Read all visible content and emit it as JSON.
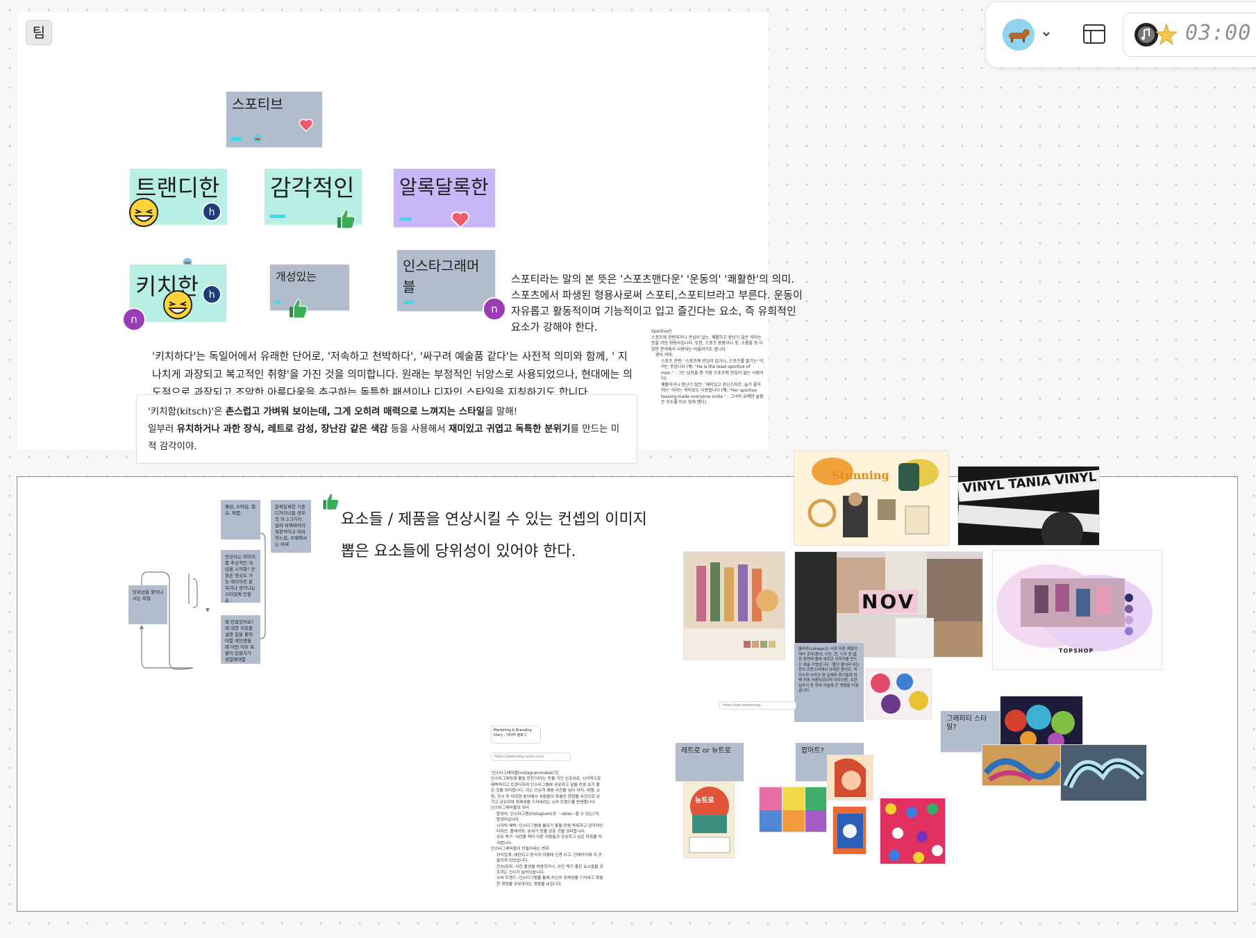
{
  "app": {
    "team_label": "팀",
    "timer": "03:00"
  },
  "board_top": {
    "stickies": {
      "root": "스포티브",
      "trendy": "트랜디한",
      "sensual": "감각적인",
      "colorful": "알록달록한",
      "kitschy": "키치한",
      "unique": "개성있는",
      "instagrammable": "인스타그래머블"
    },
    "avatars": {
      "h": "h",
      "n": "n"
    },
    "sporty_text": "스포티라는 말의 본 뜻은 '스포츠맨다운' '운동의' '쾌활한'의 의미. 스포츠에서 파생된 형용사로써 스포티,스포티브라고 부른다. 운동이 자유롭고 활동적이며 기능적이고 입고 즐긴다는 요소, 즉 유희적인 요소가 강해야 한다.",
    "kitsch_text": "'키치하다'는 독일어에서 유래한 단어로, '저속하고 천박하다', '싸구려 예술품 같다'는 사전적 의미와 함께, ' 지나치게 과장되고 복고적인 취향'을 가진 것을 의미합니다. 원래는 부정적인 뉘앙스로 사용되었으나, 현대에는 의도적으로 과장되고 조악한 아름다움을 추구하는 독특한 패션이나 디자인 스타일을 지칭하기도 합니다.",
    "kitsch_card": {
      "line1_a": "'키치함(kitsch)'은 ",
      "line1_b": "촌스럽고 가벼워 보이는데, 그게 오히려 매력으로 느껴지는 스타일",
      "line1_c": "을 말해!",
      "line2_a": "일부러 ",
      "line2_b": "유치하거나 과한 장식, 레트로 감성, 장난감 같은 색감",
      "line2_c": " 등을 사용해서 ",
      "line2_d": "재미있고 귀엽고 독특한 분위기",
      "line2_e": "를 만드는 미적 감각이야."
    },
    "sportive_note": {
      "title": "Sportive는",
      "body": "스포츠에 관련되거나 관심이 있는, 쾌활하고 장난기 많은 의미는 뜻을 가진 형용사입니다. 또한, 스포츠 용품이나 옷, 소품을 등 다양한 분야에서 사용되는 어울리기도 합니다.",
      "list_title": "영어 의미:",
      "item1": "스포츠 관련: '스포츠에 관심이 있거나, 스포츠를 즐기는' 이라는 뜻입니다 (예: \"He is the least sportive of men.\" - 그는 남자들 중 가장 스포츠에 관심이 없는 사람이다).",
      "item2": "쾌활하거나 장난기 많은: '재미있고 장난스러운, 놀기 좋아하는' 이라는 의미로도 사용됩니다 (예: \"Her sportive teasing made everyone smile.\" - 그녀의 유쾌한 놀림은 모두를 미소 짓게 했다)."
    }
  },
  "board_bottom": {
    "headline1": "요소들 / 제품을 연상시킬 수 있는 컨셉의 이미지",
    "headline2": "뽑은 요소들에 당위성이 있어야 한다.",
    "flow_notes": {
      "n1": "패션, 스타일, 필요, 제품,",
      "n2": "알록달록한 기존 디자이너들 경우의 이 2,3가지 알려 바꿔봐야지 독창적이고 따라하느낌, 수제에서는 비세",
      "n3": "연상되는 이미지를 추상적인 개념을 시각화? 만들은 영상도 가능 레이아웃 분위기나 생각나는 스타일에 만들은...",
      "n4": "왜 만들었어요? 에 대한 이유를 설명 칩을 붙여야함 레인명을 때 어떤 이유 포괄지 있을지가 경험해야함",
      "n5": "당위성을 찾아나서는 작업"
    },
    "mid_labels": {
      "retro": "레트로 or 뉴트로",
      "popart": "팝아트?",
      "graffiti": "그래피티 스타일?"
    },
    "marketing_card": "Marketing & Branding Diary - 네이버 블로그",
    "marketing_url": "https://www.blog.naver.com/",
    "insta_note": {
      "title": "'인스타그래머블(instagrammable)'은",
      "body": "인스타그래밍에 올릴 만한'이라는 뜻을 가진 신조어로, 시각적으로 매력적이고 트렌디하여 인스타그램에 공유하고 싶을 만큼 보기 좋은 것을 의미합니다. 이는 단순히 예쁜 사진을 넘어 의식, 여행, 쇼핑, 전시 등 다양한 분야에서 사람들이 특별한 경험을 사진으로 남기고 공유하여 정체성을 드러내려는 소비 트렌드를 반영합니다.",
      "sub1": "인스타그래머블의 의미",
      "b1": "합성어: 인스타그램(Instagram)과 '~able(~할 수 있는)'의 합성어입니다.",
      "b2": "시각적 매력: 인스타그램에 올리기 좋을 만큼 독특하고 감각적인 디자인, 플레이팅, 분위기 등을 갖춘 것을 의미합니다.",
      "b3": "공유 욕구: 사진을 찍어 다른 사람들과 공유하고 싶은 마음을 자극합니다.",
      "sub2": "인스타그래머블이 만들어내는 변화",
      "b4": "외식업계: 세련되고 음식의 외형에 신경 쓰고, 인테리어에 더 공들이게 되었습니다.",
      "b5": "전시/문화: 사진 촬영을 허용하거나, 사진 찍기 좋은 요소들을 강조하는 전시가 늘어났습니다.",
      "b6": "소비 트렌드: 인스타그램을 통해 자신의 정체성을 드러내고 특별한 경험을 공유하려는 경향을 보입니다."
    },
    "collage_note": "콜라주(collage)는 서로 다른 재질의 여러 조각(종이, 사진, 천, 나무 등)을 한 화면에 붙여 새로운 이미지를 만드는 예술 기법입니다. '붙이 붙이다'라는 뜻의 프랑스어에서 유래한 용어로, 피카소와 브라크 등 입체파 화가들에 의해 처음 사용되었으며 다다이즘, 초현실주의 등 현대 미술에 큰 영향을 미쳤습니다.",
    "link_chip": "https://opt.bundesreg...",
    "vinyl_text": "VINYL TANIA VINYL TANIA",
    "collage_nov": "NOV",
    "stunning": "Stunning",
    "newtro": "뉴트로",
    "topshop": "TOPSHOP"
  },
  "colors": {
    "sticky_blue": "#b1bccd",
    "sticky_mint": "#b7efe5",
    "sticky_purple": "#c8b7f6",
    "avatar_h": "#1c3f7a",
    "avatar_n": "#9b3bb5",
    "accent_cyan": "#3fd9eb"
  }
}
